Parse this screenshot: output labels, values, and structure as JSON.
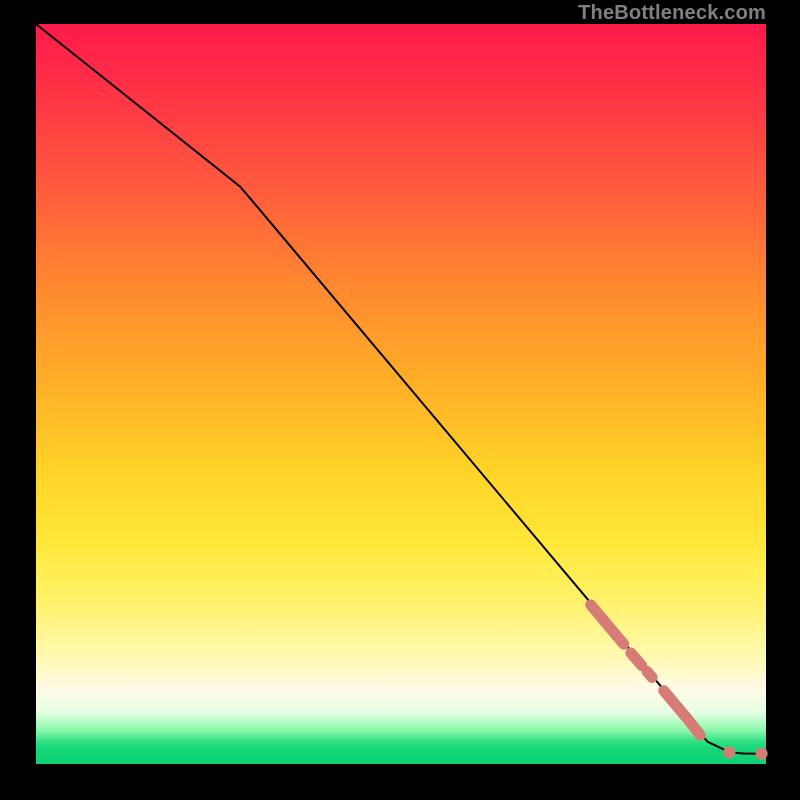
{
  "watermark": "TheBottleneck.com",
  "chart_data": {
    "type": "line",
    "title": "",
    "xlabel": "",
    "ylabel": "",
    "xlim": [
      0,
      100
    ],
    "ylim": [
      0,
      100
    ],
    "grid": false,
    "legend": false,
    "background": "rainbow-vertical-gradient",
    "curve_points": [
      {
        "x": 0,
        "y": 100
      },
      {
        "x": 28,
        "y": 78
      },
      {
        "x": 92,
        "y": 3.0
      },
      {
        "x": 95,
        "y": 1.6
      },
      {
        "x": 97,
        "y": 1.4
      },
      {
        "x": 100,
        "y": 1.4
      }
    ],
    "highlight_segments": [
      {
        "x0": 76.0,
        "y0": 21.5,
        "x1": 80.5,
        "y1": 16.2
      },
      {
        "x0": 81.5,
        "y0": 15.0,
        "x1": 83.0,
        "y1": 13.3
      },
      {
        "x0": 83.7,
        "y0": 12.5,
        "x1": 84.4,
        "y1": 11.7
      },
      {
        "x0": 86.0,
        "y0": 9.9,
        "x1": 88.9,
        "y1": 6.5
      },
      {
        "x0": 89.1,
        "y0": 6.3,
        "x1": 91.0,
        "y1": 3.9
      }
    ],
    "markers": [
      {
        "x": 95.0,
        "y": 1.6,
        "r": 5.5
      },
      {
        "x": 99.4,
        "y": 1.4,
        "r": 5.5
      }
    ]
  }
}
